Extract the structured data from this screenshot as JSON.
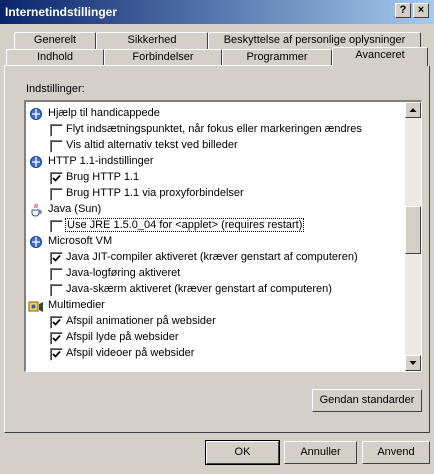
{
  "window": {
    "title": "Internetindstillinger"
  },
  "title_buttons": {
    "help": "?",
    "close": "×"
  },
  "tabs": {
    "back_row": [
      "Generelt",
      "Sikkerhed",
      "Beskyttelse af personlige oplysninger"
    ],
    "front_row": [
      "Indhold",
      "Forbindelser",
      "Programmer",
      "Avanceret"
    ],
    "active": "Avanceret"
  },
  "settings_label": "Indstillinger:",
  "settings": [
    {
      "type": "group",
      "icon": "ie-settings-icon",
      "label": "Hjælp til handicappede"
    },
    {
      "type": "checkbox",
      "checked": false,
      "label": "Flyt indsætningspunktet, når fokus eller markeringen ændres"
    },
    {
      "type": "checkbox",
      "checked": false,
      "label": "Vis altid alternativ tekst ved billeder"
    },
    {
      "type": "group",
      "icon": "ie-settings-icon",
      "label": "HTTP 1.1-indstillinger"
    },
    {
      "type": "checkbox",
      "checked": true,
      "label": "Brug HTTP 1.1"
    },
    {
      "type": "checkbox",
      "checked": false,
      "label": "Brug HTTP 1.1 via proxyforbindelser"
    },
    {
      "type": "group",
      "icon": "java-cup-icon",
      "label": "Java (Sun)"
    },
    {
      "type": "checkbox",
      "checked": false,
      "label": "Use JRE 1.5.0_04 for <applet> (requires restart)",
      "selected": true
    },
    {
      "type": "group",
      "icon": "ie-settings-icon",
      "label": "Microsoft VM"
    },
    {
      "type": "checkbox",
      "checked": true,
      "label": "Java JIT-compiler aktiveret (kræver genstart af computeren)"
    },
    {
      "type": "checkbox",
      "checked": false,
      "label": "Java-logføring aktiveret"
    },
    {
      "type": "checkbox",
      "checked": false,
      "label": "Java-skærm aktiveret (kræver genstart af computeren)"
    },
    {
      "type": "group",
      "icon": "multimedia-icon",
      "label": "Multimedier"
    },
    {
      "type": "checkbox",
      "checked": true,
      "label": "Afspil animationer på websider"
    },
    {
      "type": "checkbox",
      "checked": true,
      "label": "Afspil lyde på websider"
    },
    {
      "type": "checkbox",
      "checked": true,
      "label": "Afspil videoer på websider"
    }
  ],
  "buttons": {
    "restore": "Gendan standarder",
    "ok": "OK",
    "cancel": "Annuller",
    "apply": "Anvend"
  },
  "colors": {
    "titlebar_start": "#0a246a",
    "titlebar_end": "#a6caf0",
    "face": "#d4d0c8",
    "selection": "#0a246a"
  }
}
